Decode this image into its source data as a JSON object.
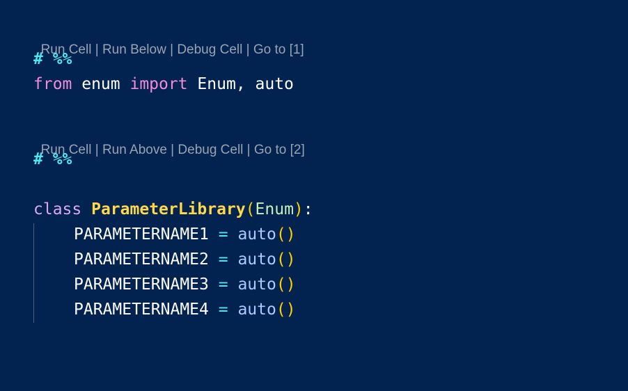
{
  "cells": [
    {
      "codelens": [
        "Run Cell",
        "Run Below",
        "Debug Cell",
        "Go to [1]"
      ],
      "marker": "# %%",
      "code": {
        "kw_from": "from",
        "module": " enum ",
        "kw_import": "import",
        "names": " Enum, auto"
      }
    },
    {
      "codelens": [
        "Run Cell",
        "Run Above",
        "Debug Cell",
        "Go to [2]"
      ],
      "marker": "# %%",
      "class_kw": "class",
      "class_name": "ParameterLibrary",
      "open_paren": "(",
      "base": "Enum",
      "close_paren": ")",
      "colon": ":",
      "members": [
        {
          "name": "PARAMETERNAME1",
          "eq": "=",
          "fn": "auto",
          "parens": "()"
        },
        {
          "name": "PARAMETERNAME2",
          "eq": "=",
          "fn": "auto",
          "parens": "()"
        },
        {
          "name": "PARAMETERNAME3",
          "eq": "=",
          "fn": "auto",
          "parens": "()"
        },
        {
          "name": "PARAMETERNAME4",
          "eq": "=",
          "fn": "auto",
          "parens": "()"
        }
      ]
    }
  ],
  "separator": " | "
}
